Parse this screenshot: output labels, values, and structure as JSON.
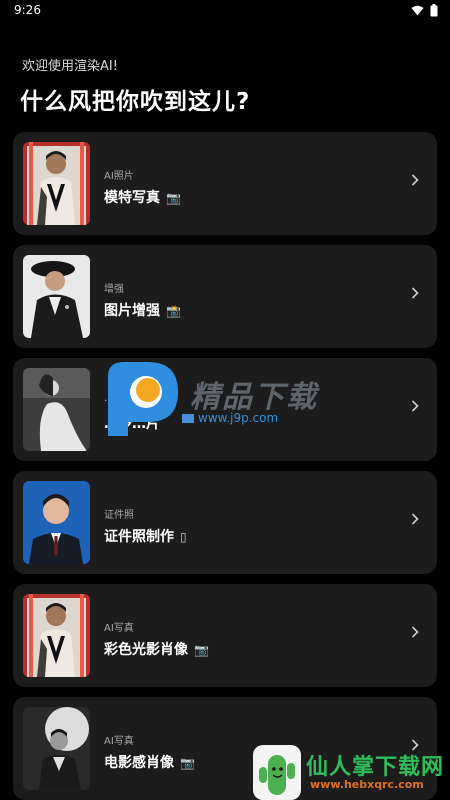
{
  "status": {
    "time": "9:26"
  },
  "header": {
    "greeting": "欢迎使用渲染AI!",
    "headline": "什么风把你吹到这儿?"
  },
  "cards": [
    {
      "category": "AI照片",
      "title": "模特写真",
      "emoji": "📷",
      "thumb": "portrait-red-bg"
    },
    {
      "category": "增强",
      "title": "图片增强",
      "emoji": "📸",
      "thumb": "portrait-beret"
    },
    {
      "category": "…",
      "title": "…多…片",
      "emoji": "",
      "thumb": "portrait-bw-woman"
    },
    {
      "category": "证件照",
      "title": "证件照制作",
      "emoji": "▯",
      "thumb": "portrait-id-blue"
    },
    {
      "category": "AI写真",
      "title": "彩色光影肖像",
      "emoji": "📷",
      "thumb": "portrait-red-bg"
    },
    {
      "category": "AI写真",
      "title": "电影感肖像",
      "emoji": "📷",
      "thumb": "portrait-bw-man"
    }
  ],
  "watermarks": {
    "center_text": "精品下载",
    "center_url": "www.j9p.com",
    "bottom_title": "仙人掌下载网",
    "bottom_url": "www.hebxqrc.com"
  },
  "colors": {
    "background": "#000000",
    "card": "#1c1c1c",
    "muted_text": "#a8a8a8"
  }
}
